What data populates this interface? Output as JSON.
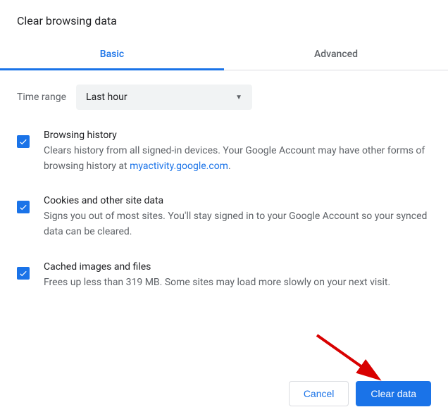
{
  "dialog_title": "Clear browsing data",
  "tabs": {
    "basic": "Basic",
    "advanced": "Advanced"
  },
  "time_range": {
    "label": "Time range",
    "selected": "Last hour"
  },
  "options": {
    "browsing_history": {
      "title": "Browsing history",
      "desc_prefix": "Clears history from all signed-in devices. Your Google Account may have other forms of browsing history at ",
      "link_text": "myactivity.google.com",
      "desc_suffix": "."
    },
    "cookies": {
      "title": "Cookies and other site data",
      "desc": "Signs you out of most sites. You'll stay signed in to your Google Account so your synced data can be cleared."
    },
    "cache": {
      "title": "Cached images and files",
      "desc": "Frees up less than 319 MB. Some sites may load more slowly on your next visit."
    }
  },
  "buttons": {
    "cancel": "Cancel",
    "clear": "Clear data"
  }
}
